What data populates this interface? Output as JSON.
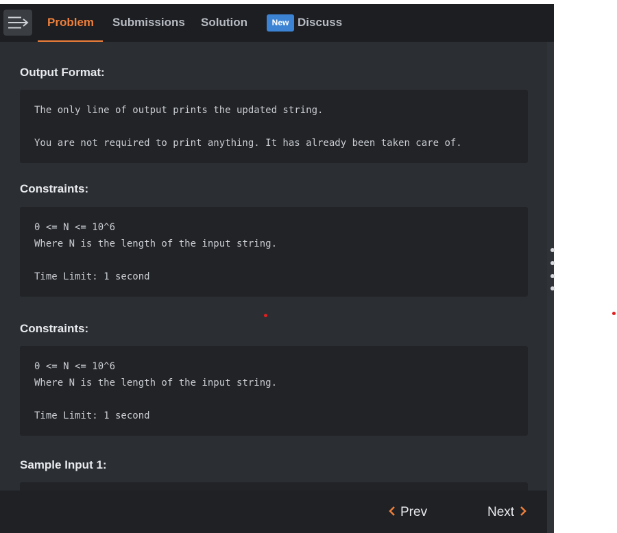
{
  "tabs": {
    "problem": "Problem",
    "submissions": "Submissions",
    "solution": "Solution",
    "new_badge": "New",
    "discuss": "Discuss"
  },
  "sections": {
    "output_format": {
      "heading": "Output Format:",
      "line1": "The only line of output prints the updated string.",
      "line2": "You are not required to print anything. It has already been taken care of."
    },
    "constraints_1": {
      "heading": "Constraints:",
      "line1": "0 <= N <= 10^6",
      "line2": "Where N is the length of the input string.",
      "line3": "Time Limit: 1 second"
    },
    "constraints_2": {
      "heading": "Constraints:",
      "line1": "0 <= N <= 10^6",
      "line2": "Where N is the length of the input string.",
      "line3": "Time Limit: 1 second"
    },
    "sample_input": {
      "heading": "Sample Input 1:"
    }
  },
  "footer": {
    "prev_label": "Prev",
    "next_label": "Next"
  },
  "colors": {
    "accent": "#f07f3a",
    "badge": "#3d83d4",
    "panel_bg": "#2b2e33",
    "code_bg": "#212327"
  },
  "icons": {
    "menu": "menu-collapse-icon",
    "prev": "chevron-left-icon",
    "next": "chevron-right-icon"
  }
}
